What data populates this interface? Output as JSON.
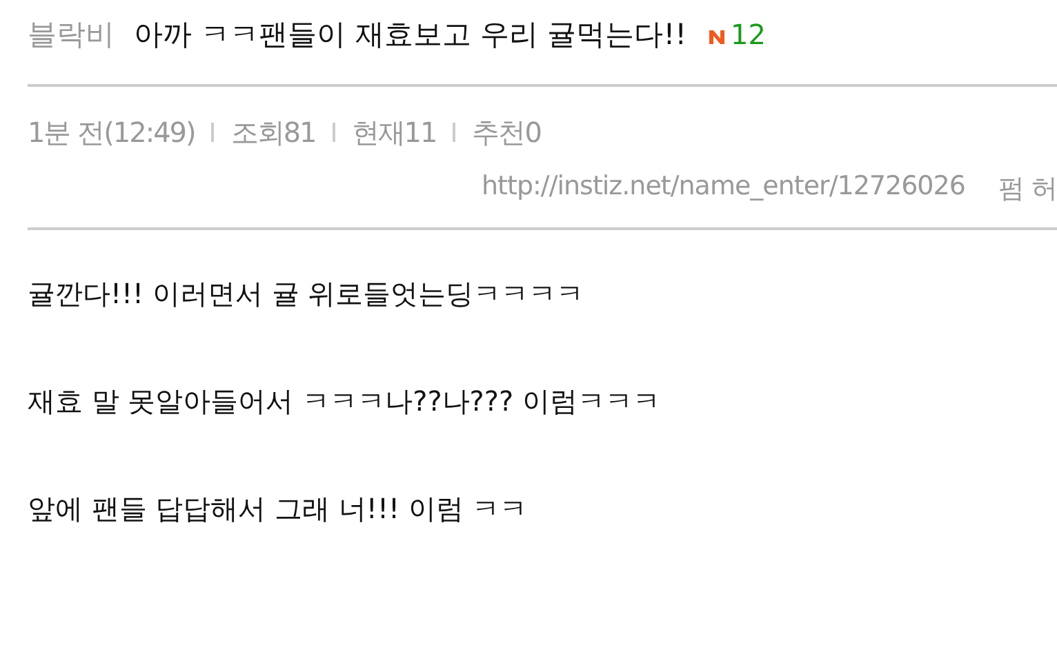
{
  "post": {
    "author": "블락비",
    "title": "아까 ㅋㅋ팬들이 재효보고 우리 귤먹는다!!",
    "new_badge": true,
    "comment_count": "12"
  },
  "meta": [
    "1분 전(12:49)",
    "조회81",
    "현재11",
    "추천0"
  ],
  "link": {
    "url": "http://instiz.net/name_enter/12726026",
    "permission": "펌 허"
  },
  "body": [
    "귤깐다!!! 이러면서 귤 위로들엇는딩ㅋㅋㅋㅋ",
    "재효 말 못알아들어서 ㅋㅋㅋ나??나??? 이럼ㅋㅋㅋ",
    "앞에 팬들 답답해서 그래 너!!! 이럼 ㅋㅋ"
  ]
}
